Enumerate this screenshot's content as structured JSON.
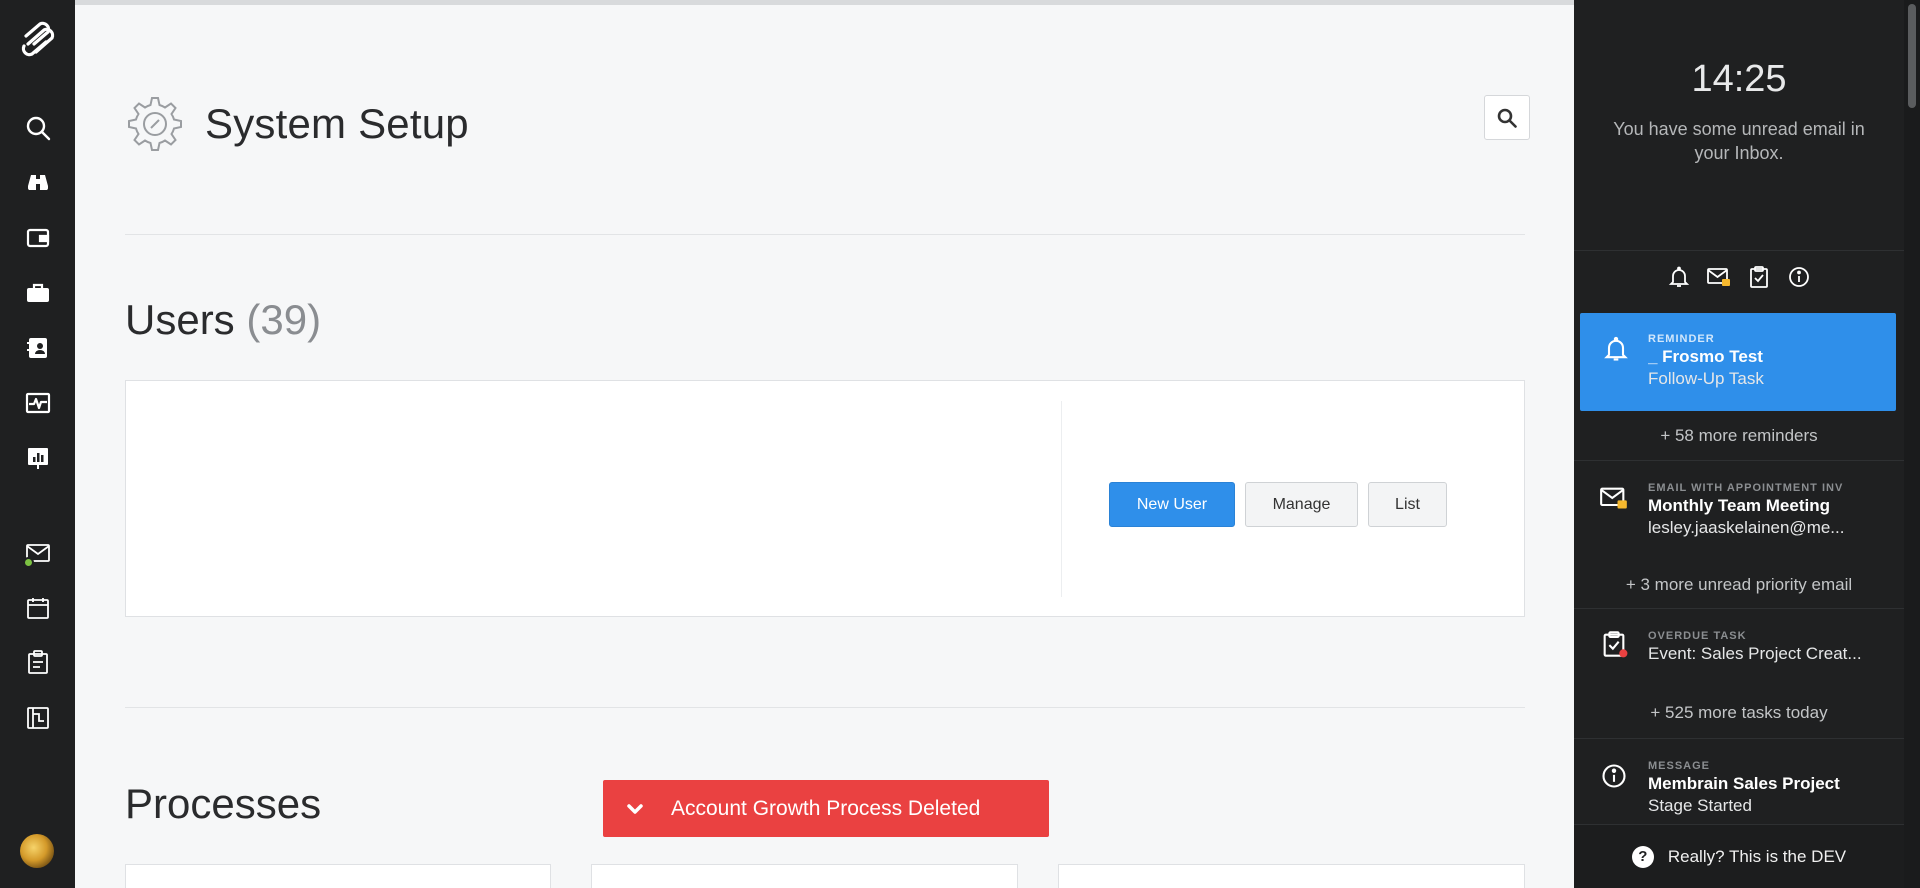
{
  "nav": {
    "items": [
      {
        "icon": "search-icon"
      },
      {
        "icon": "binoculars-icon"
      },
      {
        "icon": "wallet-icon"
      },
      {
        "icon": "briefcase-icon"
      },
      {
        "icon": "contacts-icon"
      },
      {
        "icon": "activity-icon"
      },
      {
        "icon": "presentation-chart-icon"
      },
      {
        "icon": "mail-icon"
      },
      {
        "icon": "calendar-icon"
      },
      {
        "icon": "clipboard-icon"
      },
      {
        "icon": "report-icon"
      }
    ],
    "status_color": "#7cc242"
  },
  "page": {
    "title": "System Setup"
  },
  "users": {
    "title": "Users",
    "count": "(39)",
    "new_user_label": "New User",
    "manage_label": "Manage",
    "list_label": "List"
  },
  "processes": {
    "title": "Processes"
  },
  "alert": {
    "text": "Account Growth Process Deleted",
    "color": "#ea4141"
  },
  "panel": {
    "clock": "14:25",
    "inbox_message": "You have some unread email in your Inbox.",
    "reminder": {
      "type": "REMINDER",
      "title": "_ Frosmo Test",
      "subtitle": "Follow-Up Task"
    },
    "more_reminders": "+ 58 more reminders",
    "email": {
      "type": "EMAIL WITH APPOINTMENT INV",
      "title": "Monthly Team Meeting",
      "subtitle": "lesley.jaaskelainen@me..."
    },
    "more_email": "+ 3 more unread priority email",
    "task": {
      "type": "OVERDUE TASK",
      "title": "Event: Sales Project Creat..."
    },
    "more_tasks": "+ 525 more tasks today",
    "message": {
      "type": "MESSAGE",
      "title": "Membrain Sales Project",
      "subtitle": "Stage Started"
    },
    "footer": "Really? This is the DEV",
    "accent": "#2f8fea"
  }
}
